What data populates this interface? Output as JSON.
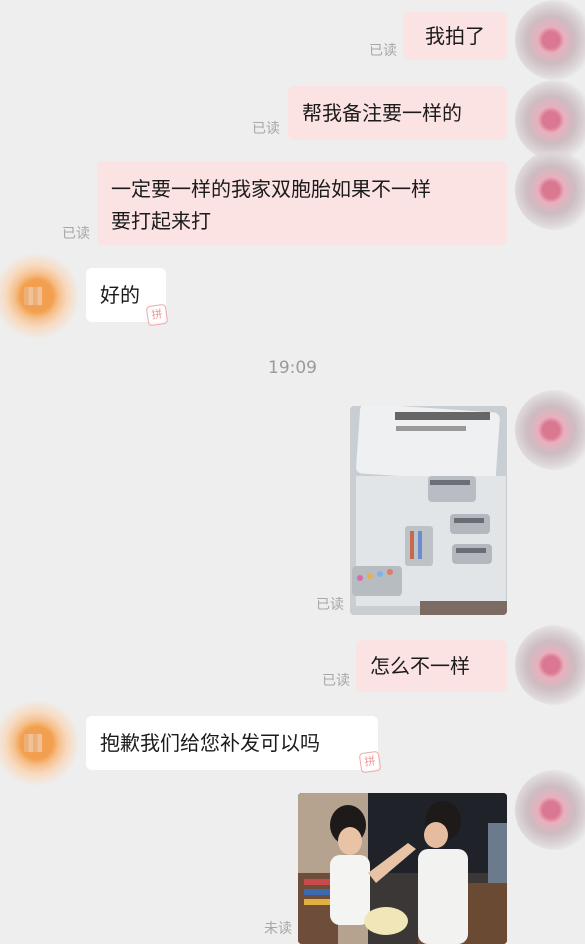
{
  "messages": {
    "m1": {
      "text": "我拍了",
      "status": "已读"
    },
    "m2": {
      "text": "帮我备注要一样的",
      "status": "已读"
    },
    "m3": {
      "line1": "一定要一样的我家双胞胎如果不一样",
      "line2": "要打起来打",
      "status": "已读"
    },
    "m4": {
      "text": "好的"
    },
    "time": "19:09",
    "m5": {
      "status": "已读"
    },
    "m6": {
      "text": "怎么不一样",
      "status": "已读"
    },
    "m7": {
      "text": "抱歉我们给您补发可以吗"
    },
    "m8": {
      "status": "未读"
    }
  }
}
